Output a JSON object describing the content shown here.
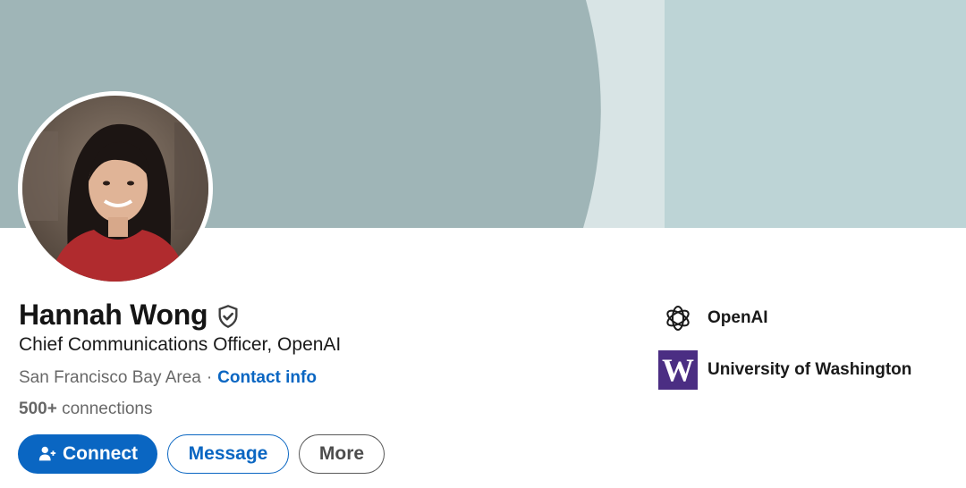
{
  "colors": {
    "banner_dark": "#9fb5b7",
    "banner_mid": "#d8e4e5",
    "banner_light": "#bdd4d6",
    "primary": "#0a66c2",
    "uw_purple": "#4b2e83"
  },
  "profile": {
    "name": "Hannah Wong",
    "headline": "Chief Communications Officer, OpenAI",
    "location": "San Francisco Bay Area",
    "separator": "·",
    "contact_info": "Contact info",
    "connections_count": "500+",
    "connections_label": "connections",
    "verified_icon": "shield-check-icon"
  },
  "actions": {
    "connect": "Connect",
    "connect_icon": "add-person-icon",
    "message": "Message",
    "more": "More"
  },
  "organizations": [
    {
      "name": "OpenAI",
      "logo_icon": "openai-logo-icon"
    },
    {
      "name": "University of Washington",
      "logo_text": "W"
    }
  ]
}
